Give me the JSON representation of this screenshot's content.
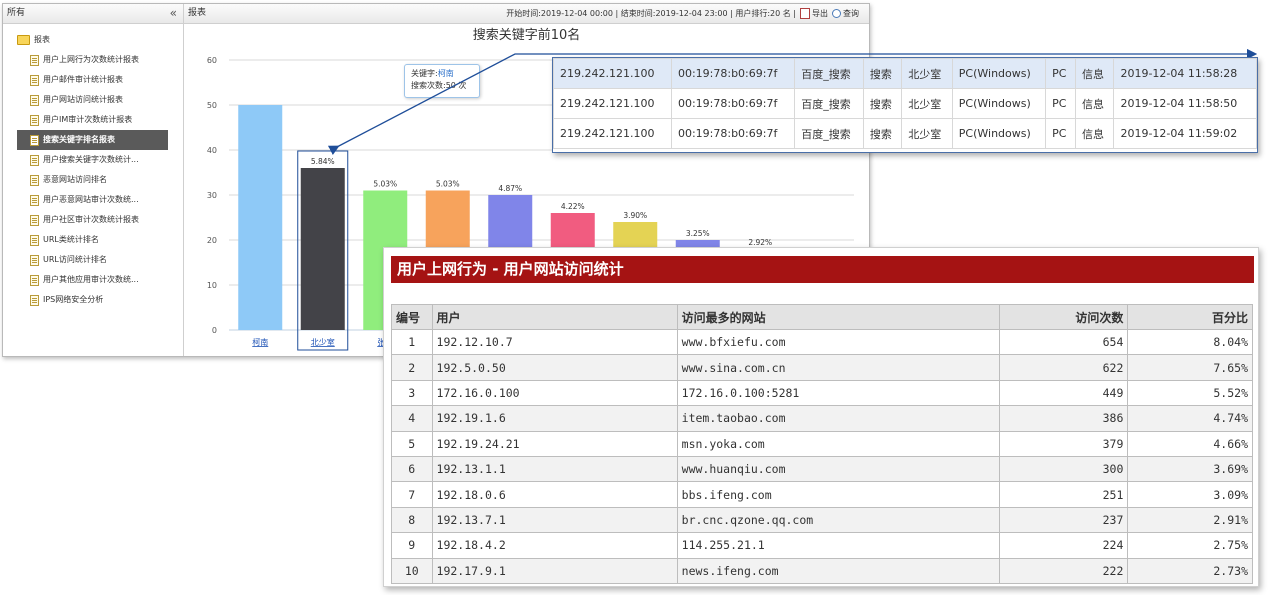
{
  "sidebar": {
    "header": "所有",
    "collapse_icon": "«",
    "root": "报表",
    "items": [
      {
        "label": "用户上网行为次数统计报表"
      },
      {
        "label": "用户邮件审计统计报表"
      },
      {
        "label": "用户网站访问统计报表"
      },
      {
        "label": "用户IM审计次数统计报表"
      },
      {
        "label": "搜索关键字排名报表",
        "active": true
      },
      {
        "label": "用户搜索关键字次数统计..."
      },
      {
        "label": "恶意网站访问排名"
      },
      {
        "label": "用户恶意网站审计次数统..."
      },
      {
        "label": "用户社区审计次数统计报表"
      },
      {
        "label": "URL类统计排名"
      },
      {
        "label": "URL访问统计排名"
      },
      {
        "label": "用户其他应用审计次数统..."
      },
      {
        "label": "IPS网络安全分析"
      }
    ]
  },
  "main": {
    "header": "报表",
    "range_text": "开始时间:2019-12-04 00:00 | 结束时间:2019-12-04 23:00 | 用户排行:20 名 |",
    "export_label": "导出",
    "query_label": "查询"
  },
  "tooltip": {
    "keyword_label": "关键字:",
    "keyword_value": "柯南",
    "count_text": "搜索次数:50 次"
  },
  "chart_data": {
    "type": "bar",
    "title": "搜索关键字前10名",
    "categories": [
      "柯南",
      "北少室",
      "张…",
      "",
      "",
      "",
      "",
      "",
      "",
      ""
    ],
    "values": [
      50,
      36,
      31,
      31,
      30,
      26,
      24,
      20,
      18,
      null
    ],
    "data_labels": [
      "",
      "5.84%",
      "5.03%",
      "5.03%",
      "4.87%",
      "4.22%",
      "3.90%",
      "3.25%",
      "2.92%",
      ""
    ],
    "colors": [
      "#8ec9f7",
      "#434348",
      "#90ed7d",
      "#f7a35c",
      "#8085e9",
      "#f15c80",
      "#e4d354",
      "#8085e8",
      "#8d4653",
      "#91e8e1"
    ],
    "ylim": [
      0,
      60
    ],
    "yticks": [
      0,
      10,
      20,
      30,
      40,
      50,
      60
    ],
    "grid": true,
    "legend": "none"
  },
  "detail": {
    "rows": [
      [
        "219.242.121.100",
        "00:19:78:b0:69:7f",
        "百度_搜索",
        "搜索",
        "北少室",
        "PC(Windows)",
        "PC",
        "信息",
        "2019-12-04 11:58:28"
      ],
      [
        "219.242.121.100",
        "00:19:78:b0:69:7f",
        "百度_搜索",
        "搜索",
        "北少室",
        "PC(Windows)",
        "PC",
        "信息",
        "2019-12-04 11:58:50"
      ],
      [
        "219.242.121.100",
        "00:19:78:b0:69:7f",
        "百度_搜索",
        "搜索",
        "北少室",
        "PC(Windows)",
        "PC",
        "信息",
        "2019-12-04 11:59:02"
      ]
    ]
  },
  "report": {
    "title": "用户上网行为 - 用户网站访问统计",
    "columns": [
      "编号",
      "用户",
      "访问最多的网站",
      "访问次数",
      "百分比"
    ],
    "rows": [
      [
        "1",
        "192.12.10.7",
        "www.bfxiefu.com",
        "654",
        "8.04%"
      ],
      [
        "2",
        "192.5.0.50",
        "www.sina.com.cn",
        "622",
        "7.65%"
      ],
      [
        "3",
        "172.16.0.100",
        "172.16.0.100:5281",
        "449",
        "5.52%"
      ],
      [
        "4",
        "192.19.1.6",
        "item.taobao.com",
        "386",
        "4.74%"
      ],
      [
        "5",
        "192.19.24.21",
        "msn.yoka.com",
        "379",
        "4.66%"
      ],
      [
        "6",
        "192.13.1.1",
        "www.huanqiu.com",
        "300",
        "3.69%"
      ],
      [
        "7",
        "192.18.0.6",
        "bbs.ifeng.com",
        "251",
        "3.09%"
      ],
      [
        "8",
        "192.13.7.1",
        "br.cnc.qzone.qq.com",
        "237",
        "2.91%"
      ],
      [
        "9",
        "192.18.4.2",
        "114.255.21.1",
        "224",
        "2.75%"
      ],
      [
        "10",
        "192.17.9.1",
        "news.ifeng.com",
        "222",
        "2.73%"
      ]
    ]
  }
}
